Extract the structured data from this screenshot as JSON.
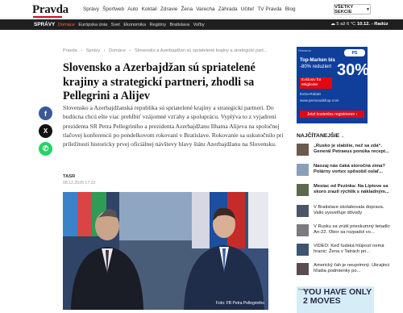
{
  "header": {
    "logo": "Pravda",
    "nav": [
      "Správy",
      "Športweb",
      "Auto",
      "Koktail",
      "Zdravie",
      "Žena",
      "Varecha",
      "Záhrada",
      "Učiteľ",
      "TV Pravda",
      "Blog"
    ],
    "all_sections": "VŠETKY SEKCIE"
  },
  "subnav": {
    "title": "SPRÁVY",
    "links": [
      "Domáce",
      "Európska únia",
      "Svet",
      "Ekonomika",
      "Regióny",
      "Bratislava",
      "Voľby"
    ],
    "active_index": 0,
    "weather": "5 až 6 °C",
    "date": "10.12. - Radúz"
  },
  "breadcrumb": [
    "Pravda",
    "›",
    "Správy",
    "›",
    "Domáce",
    "›",
    "Slovensko a Azerbajdžan sú spriatelené krajiny a strategickí part..."
  ],
  "article": {
    "headline": "Slovensko a Azerbajdžan sú spriatelené krajiny a strategickí partneri, zhodli sa Pellegrini a Alijev",
    "perex": "Slovensko a Azerbajdžanská republika sú spriatelené krajiny a strategickí partneri. Do budúcna chcú ešte viac prehĺbiť vzájomné vzťahy a spoluprácu. Vyplýva to z vyjadrení prezidenta SR Petra Pellegriniho a prezidenta Azerbajdžanu Ilhama Alijeva na spoločnej tlačovej konferencii po pondelkovom rokovaní v Bratislave. Rokovanie sa uskutočnilo pri príležitosti historicky prvej oficiálnej návštevy hlavy štátu Azerbajdžanu na Slovensku.",
    "author": "TASR",
    "published": "08.12.2025 17:22",
    "photo_credit": "Foto: FB Petra Pellegriniho"
  },
  "share": {
    "facebook": "f",
    "x": "X",
    "whatsapp": "✆"
  },
  "ad_top": {
    "tag": "Reklama",
    "line1": "Top-Marken bis",
    "line2": "-80% reduziert",
    "percent": "30%",
    "badge": "Exklusiv für Mitglieder",
    "line3": "Extra-Rabatt",
    "line4": "www.personalshop.com",
    "button": "Jetzt kostenlos registrieren ›",
    "logo": "PS"
  },
  "newest": {
    "title": "NAJČÍTANEJŠIE",
    "chevron": "⌄",
    "items": [
      {
        "text": "„Rusko je slabšie, než sa zdá“. Generál Petraeus ponúka recept...",
        "bold": true
      },
      {
        "text": "Naozaj nás čaká storočná zima? Polárny vortex spôsobil oslaľ...",
        "bold": true
      },
      {
        "text": "Mesiac od Pezinka: Na Liptove sa skoro zrazil rýchlik s nákladným...",
        "bold": true
      },
      {
        "text": "V Bratislave skolabovala doprava. Vallo vysvetľuje dôvody",
        "bold": false
      },
      {
        "text": "V Rusku sa zrútil prieskumný lietadlo An-22. Obor sa rozpadol vo...",
        "bold": false
      },
      {
        "text": "VIDEO: Keď ľudská hlúposť nemá hranic: Žena v Tatrách pri...",
        "bold": false
      },
      {
        "text": "Americký ťah je neuprimný. Ukrajinci hľadia podmienky po...",
        "bold": false
      }
    ]
  },
  "ad_bottom": {
    "tag": "Reklama",
    "text": "YOU HAVE ONLY 2 MOVES"
  },
  "colors": {
    "brand_red": "#c8102e",
    "dark_bar": "#1f1f1f",
    "active_link": "#ff6a3d",
    "ad_blue": "#0f3f9a"
  }
}
